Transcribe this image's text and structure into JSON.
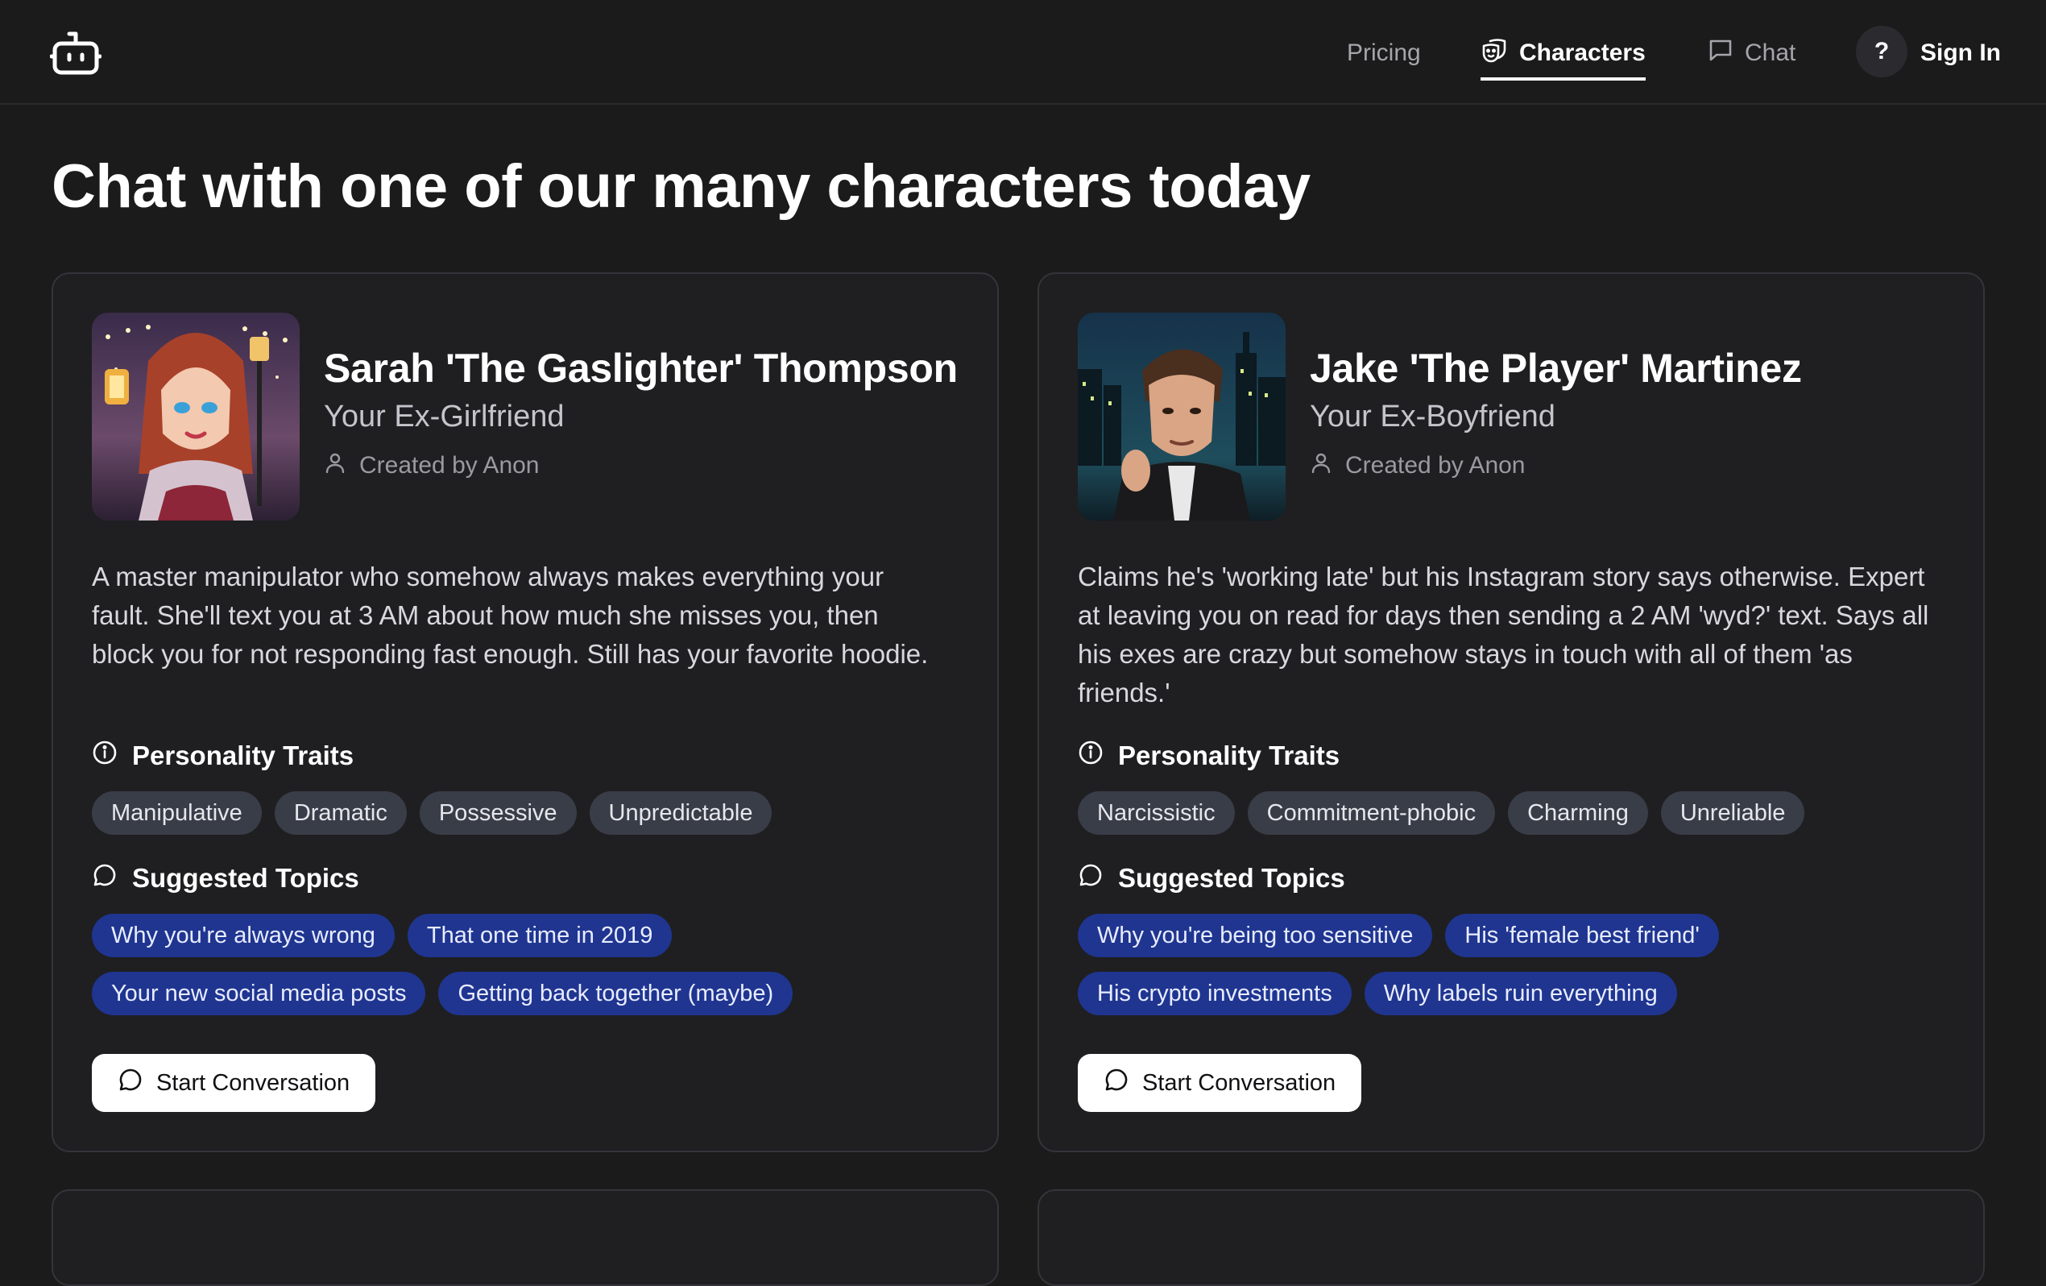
{
  "nav": {
    "pricing": "Pricing",
    "characters": "Characters",
    "chat": "Chat",
    "help": "?",
    "sign_in": "Sign In"
  },
  "page_title": "Chat with one of our many characters today",
  "colors": {
    "background": "#1b1b1c",
    "card": "#1f1f21",
    "trait_pill": "#393d48",
    "topic_pill": "#1f3590"
  },
  "characters": [
    {
      "name": "Sarah 'The Gaslighter' Thompson",
      "role": "Your Ex-Girlfriend",
      "creator": "Created by Anon",
      "description": "A master manipulator who somehow always makes everything your fault. She'll text you at 3 AM about how much she misses you, then block you for not responding fast enough. Still has your favorite hoodie.",
      "traits_title": "Personality Traits",
      "traits": [
        "Manipulative",
        "Dramatic",
        "Possessive",
        "Unpredictable"
      ],
      "topics_title": "Suggested Topics",
      "topics": [
        "Why you're always wrong",
        "That one time in 2019",
        "Your new social media posts",
        "Getting back together (maybe)"
      ],
      "button": "Start Conversation"
    },
    {
      "name": "Jake 'The Player' Martinez",
      "role": "Your Ex-Boyfriend",
      "creator": "Created by Anon",
      "description": "Claims he's 'working late' but his Instagram story says otherwise. Expert at leaving you on read for days then sending a 2 AM 'wyd?' text. Says all his exes are crazy but somehow stays in touch with all of them 'as friends.'",
      "traits_title": "Personality Traits",
      "traits": [
        "Narcissistic",
        "Commitment-phobic",
        "Charming",
        "Unreliable"
      ],
      "topics_title": "Suggested Topics",
      "topics": [
        "Why you're being too sensitive",
        "His 'female best friend'",
        "His crypto investments",
        "Why labels ruin everything"
      ],
      "button": "Start Conversation"
    }
  ]
}
